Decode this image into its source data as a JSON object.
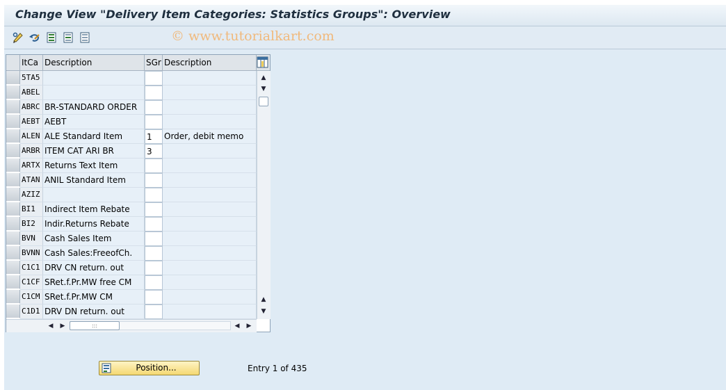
{
  "window": {
    "title": "Change View \"Delivery Item Categories: Statistics Groups\": Overview",
    "watermark": "© www.tutorialkart.com"
  },
  "toolbar": {
    "buttons": [
      {
        "icon": "display-change-icon"
      },
      {
        "icon": "undo-icon"
      },
      {
        "icon": "select-all-icon"
      },
      {
        "icon": "select-block-icon"
      },
      {
        "icon": "deselect-all-icon"
      }
    ]
  },
  "table": {
    "columns": {
      "itca": "ItCa",
      "desc1": "Description",
      "sgr": "SGr",
      "desc2": "Description"
    },
    "rows": [
      {
        "itca": "5TA5",
        "desc1": "",
        "sgr": "",
        "desc2": ""
      },
      {
        "itca": "ABEL",
        "desc1": "",
        "sgr": "",
        "desc2": ""
      },
      {
        "itca": "ABRC",
        "desc1": "BR-STANDARD ORDER",
        "sgr": "",
        "desc2": ""
      },
      {
        "itca": "AEBT",
        "desc1": "AEBT",
        "sgr": "",
        "desc2": ""
      },
      {
        "itca": "ALEN",
        "desc1": "ALE Standard Item",
        "sgr": "1",
        "desc2": "Order, debit memo"
      },
      {
        "itca": "ARBR",
        "desc1": "ITEM CAT ARI BR",
        "sgr": "3",
        "desc2": ""
      },
      {
        "itca": "ARTX",
        "desc1": "Returns Text Item",
        "sgr": "",
        "desc2": ""
      },
      {
        "itca": "ATAN",
        "desc1": " ANIL Standard Item",
        "sgr": "",
        "desc2": ""
      },
      {
        "itca": "AZIZ",
        "desc1": "",
        "sgr": "",
        "desc2": ""
      },
      {
        "itca": "BI1",
        "desc1": "Indirect Item Rebate",
        "sgr": "",
        "desc2": ""
      },
      {
        "itca": "BI2",
        "desc1": "Indir.Returns Rebate",
        "sgr": "",
        "desc2": ""
      },
      {
        "itca": "BVN",
        "desc1": "Cash Sales Item",
        "sgr": "",
        "desc2": ""
      },
      {
        "itca": "BVNN",
        "desc1": "Cash Sales:FreeofCh.",
        "sgr": "",
        "desc2": ""
      },
      {
        "itca": "C1C1",
        "desc1": "DRV CN return. out",
        "sgr": "",
        "desc2": ""
      },
      {
        "itca": "C1CF",
        "desc1": "SRet.f.Pr.MW free CM",
        "sgr": "",
        "desc2": ""
      },
      {
        "itca": "C1CM",
        "desc1": "SRet.f.Pr.MW CM",
        "sgr": "",
        "desc2": ""
      },
      {
        "itca": "C1D1",
        "desc1": "DRV DN return. out",
        "sgr": "",
        "desc2": ""
      }
    ]
  },
  "footer": {
    "position_button": "Position...",
    "entry_text": "Entry 1 of 435"
  },
  "colors": {
    "background": "#dfebf5",
    "button_yellow": "#f4d872",
    "watermark": "#f0b97c"
  }
}
